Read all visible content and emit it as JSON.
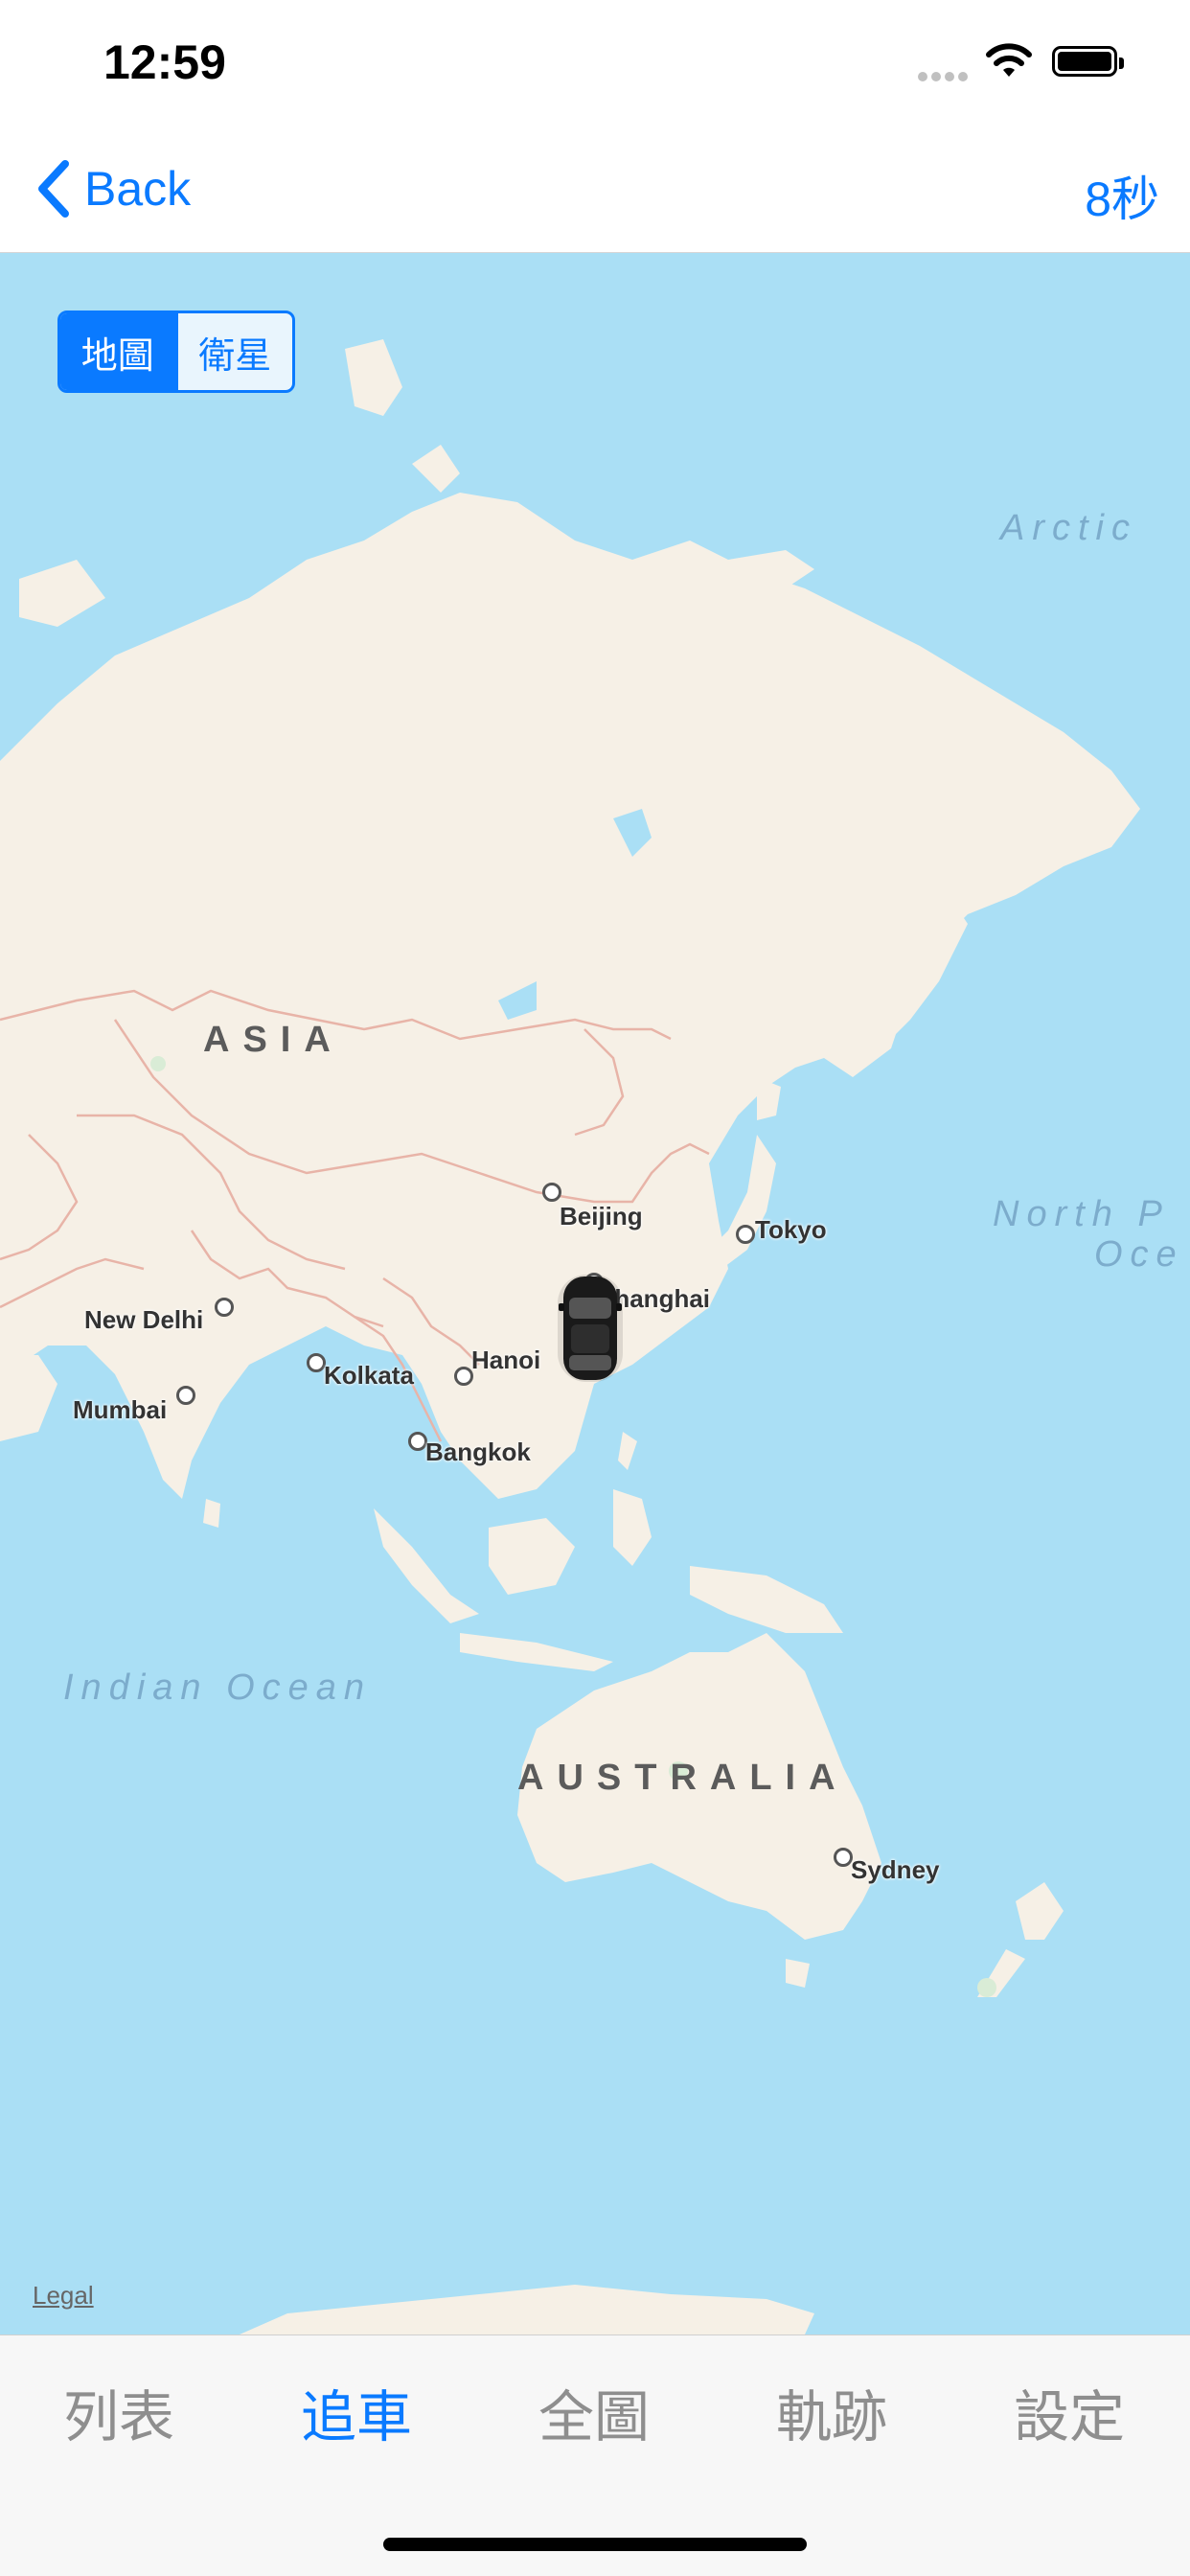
{
  "status_bar": {
    "time": "12:59"
  },
  "nav": {
    "back_label": "Back",
    "timer_label": "8秒"
  },
  "map": {
    "map_type_options": [
      "地圖",
      "衛星"
    ],
    "selected_map_type": "地圖",
    "regions": [
      "ASIA",
      "AUSTRALIA"
    ],
    "oceans": [
      "Arctic",
      "North P",
      "Oce",
      "Indian Ocean"
    ],
    "cities": [
      "Beijing",
      "Tokyo",
      "Shanghai",
      "Hanoi",
      "New Delhi",
      "Kolkata",
      "Mumbai",
      "Bangkok",
      "Sydney"
    ],
    "legal_label": "Legal",
    "colors": {
      "water": "#aadff5",
      "land": "#f6f0e6",
      "border": "#e8b4a8"
    }
  },
  "tabs": [
    "列表",
    "追車",
    "全圖",
    "軌跡",
    "設定"
  ],
  "selected_tab": "追車",
  "colors": {
    "accent": "#0a7aff",
    "inactive_tab": "#8e8e8e"
  }
}
